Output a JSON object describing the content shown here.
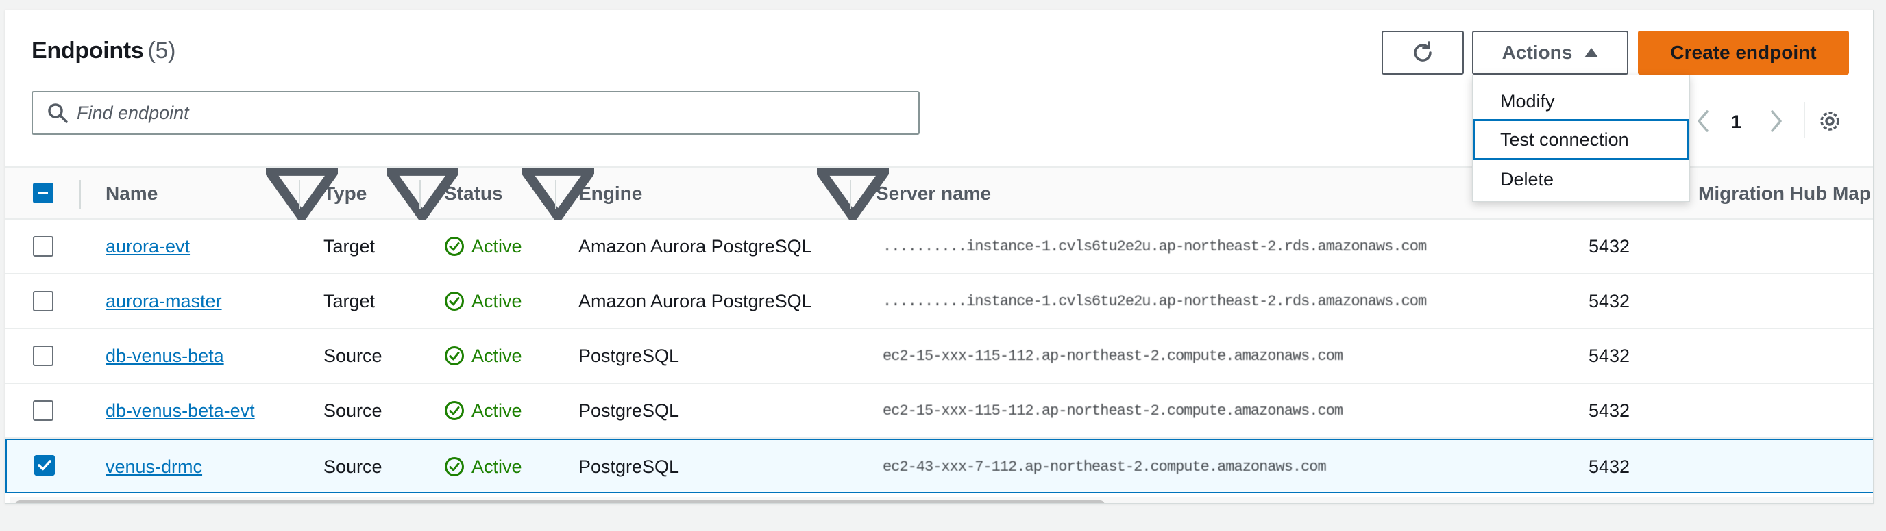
{
  "header": {
    "title": "Endpoints",
    "count": "(5)"
  },
  "search": {
    "placeholder": "Find endpoint"
  },
  "toolbar": {
    "actions_label": "Actions",
    "create_label": "Create endpoint"
  },
  "actions_menu": {
    "items": [
      "Modify",
      "Test connection",
      "Delete"
    ],
    "focused": "Test connection"
  },
  "pagination": {
    "page": "1"
  },
  "columns": [
    "Name",
    "Type",
    "Status",
    "Engine",
    "Server name",
    "Migration Hub Map"
  ],
  "rows": [
    {
      "name": "aurora-evt",
      "type": "Target",
      "status": "Active",
      "engine": "Amazon Aurora PostgreSQL",
      "server": "..........instance-1.cvls6tu2e2u.ap-northeast-2.rds.amazonaws.com",
      "port": "5432",
      "selected": false
    },
    {
      "name": "aurora-master",
      "type": "Target",
      "status": "Active",
      "engine": "Amazon Aurora PostgreSQL",
      "server": "..........instance-1.cvls6tu2e2u.ap-northeast-2.rds.amazonaws.com",
      "port": "5432",
      "selected": false
    },
    {
      "name": "db-venus-beta",
      "type": "Source",
      "status": "Active",
      "engine": "PostgreSQL",
      "server": "ec2-15-xxx-115-112.ap-northeast-2.compute.amazonaws.com",
      "port": "5432",
      "selected": false
    },
    {
      "name": "db-venus-beta-evt",
      "type": "Source",
      "status": "Active",
      "engine": "PostgreSQL",
      "server": "ec2-15-xxx-115-112.ap-northeast-2.compute.amazonaws.com",
      "port": "5432",
      "selected": false
    },
    {
      "name": "venus-drmc",
      "type": "Source",
      "status": "Active",
      "engine": "PostgreSQL",
      "server": "ec2-43-xxx-7-112.ap-northeast-2.compute.amazonaws.com",
      "port": "5432",
      "selected": true
    }
  ],
  "colors": {
    "link": "#0073bb",
    "primary": "#ec7211",
    "success": "#1d8102",
    "focus": "#0073bb"
  },
  "icons": {
    "refresh": "refresh-icon",
    "search": "search-icon",
    "settings": "gear-icon",
    "caret": "caret-up-icon",
    "status": "check-circle-icon"
  }
}
